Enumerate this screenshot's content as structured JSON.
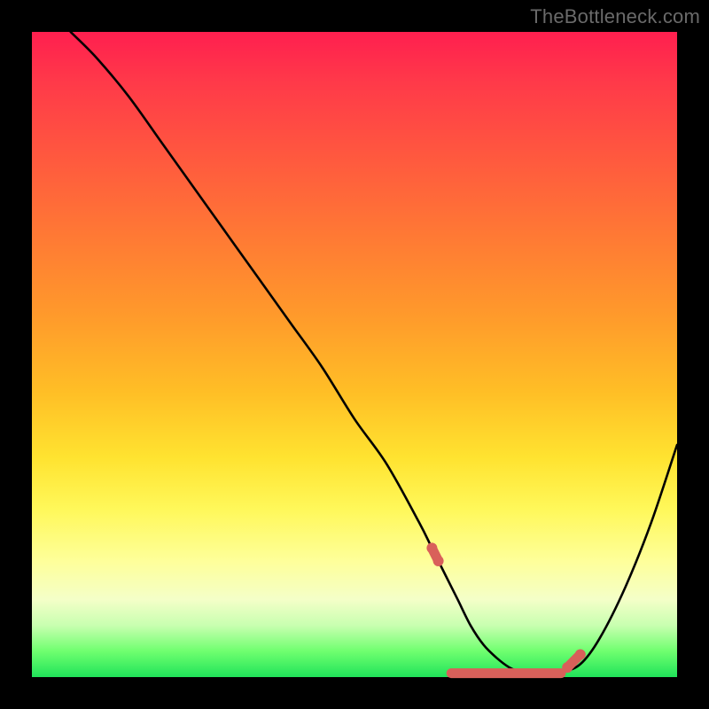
{
  "watermark": "TheBottleneck.com",
  "colors": {
    "background": "#000000",
    "gradient_top": "#ff1f4f",
    "gradient_mid": "#ffe330",
    "gradient_bottom": "#20e35a",
    "curve": "#000000",
    "highlight": "#d9605a"
  },
  "chart_data": {
    "type": "line",
    "title": "",
    "xlabel": "",
    "ylabel": "",
    "xlim": [
      0,
      100
    ],
    "ylim": [
      0,
      100
    ],
    "grid": false,
    "legend": false,
    "series": [
      {
        "name": "bottleneck-curve",
        "x": [
          6,
          10,
          15,
          20,
          25,
          30,
          35,
          40,
          45,
          50,
          55,
          60,
          62,
          64,
          66,
          68,
          70,
          72,
          74,
          76,
          78,
          80,
          82,
          85,
          88,
          92,
          96,
          100
        ],
        "values": [
          100,
          96,
          90,
          83,
          76,
          69,
          62,
          55,
          48,
          40,
          33,
          24,
          20,
          16,
          12,
          8,
          5,
          3,
          1.5,
          0.7,
          0.4,
          0.4,
          0.7,
          2,
          6,
          14,
          24,
          36
        ]
      }
    ],
    "highlight_segments": [
      {
        "name": "left-dot",
        "x": [
          62,
          63
        ],
        "values": [
          20,
          18
        ]
      },
      {
        "name": "valley",
        "x": [
          65,
          82
        ],
        "values": [
          0.6,
          0.6
        ]
      },
      {
        "name": "right-dot",
        "x": [
          83,
          85
        ],
        "values": [
          1.5,
          3.5
        ]
      }
    ]
  }
}
